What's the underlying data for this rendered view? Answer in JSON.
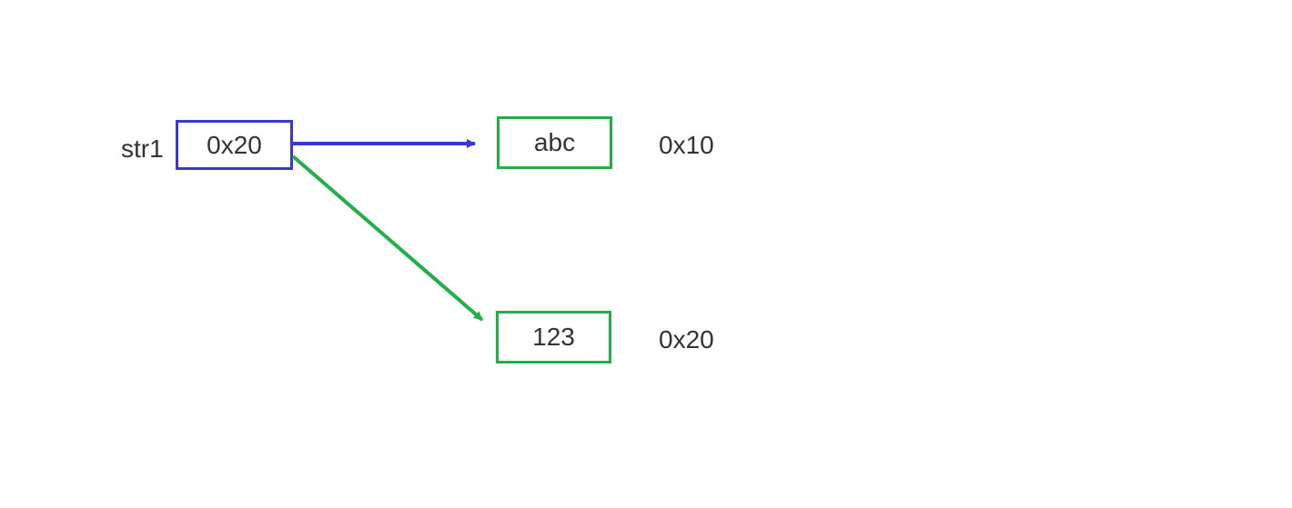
{
  "variable": {
    "name": "str1",
    "value": "0x20"
  },
  "object1": {
    "value": "abc",
    "address": "0x10"
  },
  "object2": {
    "value": "123",
    "address": "0x20"
  },
  "colors": {
    "blue": "#3838d4",
    "green": "#1fb04a"
  }
}
